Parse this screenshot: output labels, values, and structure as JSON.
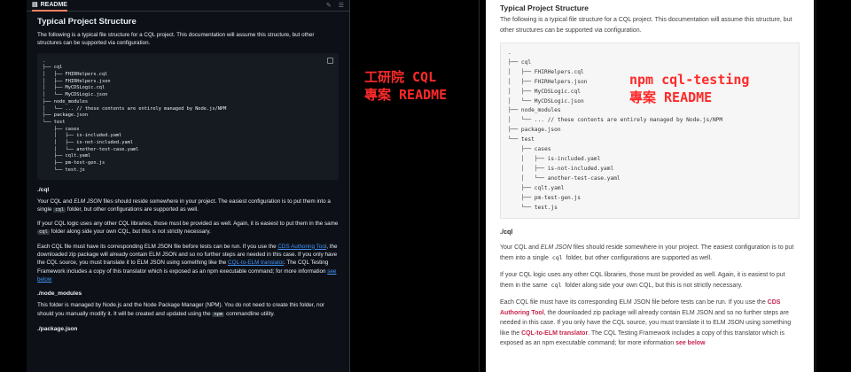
{
  "left": {
    "tab_label": "README",
    "title": "Typical Project Structure",
    "intro": "The following is a typical file structure for a CQL project. This documentation will assume this structure, but other structures can be supported via configuration.",
    "tree": ".\n├── cql\n│   ├── FHIRHelpers.cql\n│   ├── FHIRHelpers.json\n│   ├── MyCDSLogic.cql\n│   └── MyCDSLogic.json\n├── node_modules\n│   └── ... // these contents are entirely managed by Node.js/NPM\n├── package.json\n└── test\n    ├── cases\n    │   ├── is-included.yaml\n    │   ├── is-not-included.yaml\n    │   └── another-test-case.yaml\n    ├── cqlt.yaml\n    ├── pm-test-gen.js\n    └── test.js",
    "cql_heading": "./cql",
    "cql_p1_a": "Your CQL and ",
    "cql_p1_em": "ELM JSON",
    "cql_p1_b": " files should reside somewhere in your project. The easiest configuration is to put them into a single ",
    "cql_p1_code": "cql",
    "cql_p1_c": " folder, but other configurations are supported as well.",
    "cql_p2_a": "If your CQL logic uses any other CQL libraries, those must be provided as well. Again, it is easiest to put them in the same ",
    "cql_p2_code": "cql",
    "cql_p2_b": " folder along side your own CQL, but this is not strictly necessary.",
    "cql_p3_a": "Each CQL file must have its corresponding ELM JSON file before tests can be run. If you use the ",
    "cql_p3_link1": "CDS Authoring Tool",
    "cql_p3_b": ", the downloaded zip package will already contain ELM JSON and so no further steps are needed in this case. If you only have the CQL source, you must translate it to ELM JSON using something like the ",
    "cql_p3_link2": "CQL-to-ELM translator",
    "cql_p3_c": ". The CQL Testing Framework includes a copy of this translator which is exposed as an npm executable command; for more information ",
    "cql_p3_link3": "see below",
    "nm_heading": "./node_modules",
    "nm_p_a": "This folder is managed by Node.js and the Node Package Manager (NPM). You do not need to create this folder, nor should you manually modify it. It will be created and updated using the ",
    "nm_p_code": "npm",
    "nm_p_b": " commandline utility.",
    "pkg_heading": "./package.json"
  },
  "annotation_left": [
    "工研院 CQL",
    "專案 README"
  ],
  "annotation_right": [
    "npm cql-testing",
    "專案 README"
  ],
  "right": {
    "title": "Typical Project Structure",
    "intro": "The following is a typical file structure for a CQL project. This documentation will assume this structure, but other structures can be supported via configuration.",
    "tree": ".\n├── cql\n│   ├── FHIRHelpers.cql\n│   ├── FHIRHelpers.json\n│   ├── MyCDSLogic.cql\n│   └── MyCDSLogic.json\n├── node_modules\n│   └── ... // these contents are entirely managed by Node.js/NPM\n├── package.json\n└── test\n    ├── cases\n    │   ├── is-included.yaml\n    │   ├── is-not-included.yaml\n    │   └── another-test-case.yaml\n    ├── cqlt.yaml\n    ├── pm-test-gen.js\n    └── test.js",
    "cql_heading": "./cql",
    "cql_p1_a": "Your CQL and ",
    "cql_p1_em": "ELM JSON",
    "cql_p1_b": " files should reside somewhere in your project. The easiest configuration is to put them into a single ",
    "cql_p1_code": "cql",
    "cql_p1_c": " folder, but other configurations are supported as well.",
    "cql_p2_a": "If your CQL logic uses any other CQL libraries, those must be provided as well. Again, it is easiest to put them in the same ",
    "cql_p2_code": "cql",
    "cql_p2_b": " folder along side your own CQL, but this is not strictly necessary.",
    "cql_p3_a": "Each CQL file must have its corresponding ELM JSON file before tests can be run. If you use the ",
    "cql_p3_link1": "CDS Authoring Tool",
    "cql_p3_b": ", the downloaded zip package will already contain ELM JSON and so no further steps are needed in this case. If you only have the CQL source, you must translate it to ELM JSON using something like the ",
    "cql_p3_link2": "CQL-to-ELM translator",
    "cql_p3_c": ". The CQL Testing Framework includes a copy of this translator which is exposed as an npm executable command; for more information ",
    "cql_p3_link3": "see below"
  },
  "colors": {
    "annotation": "#ff2a2a",
    "link_dark": "#4493f8",
    "link_light": "#c7254e"
  }
}
